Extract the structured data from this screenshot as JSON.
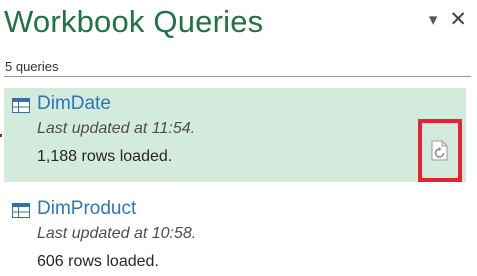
{
  "pane": {
    "title": "Workbook Queries",
    "count_label": "5 queries"
  },
  "controls": {
    "dropdown_glyph": "▾",
    "close_glyph": "✕"
  },
  "queries": [
    {
      "name": "DimDate",
      "updated": "Last updated at 11:54.",
      "rows": "1,188 rows loaded.",
      "selected": true
    },
    {
      "name": "DimProduct",
      "updated": "Last updated at 10:58.",
      "rows": "606 rows loaded.",
      "selected": false
    }
  ],
  "colors": {
    "title": "#217346",
    "query_name": "#2e75b6",
    "selected_background": "#d3ebdc",
    "highlight_border": "#e8232f"
  },
  "icons": {
    "table": "table-icon",
    "refresh": "refresh-icon"
  }
}
